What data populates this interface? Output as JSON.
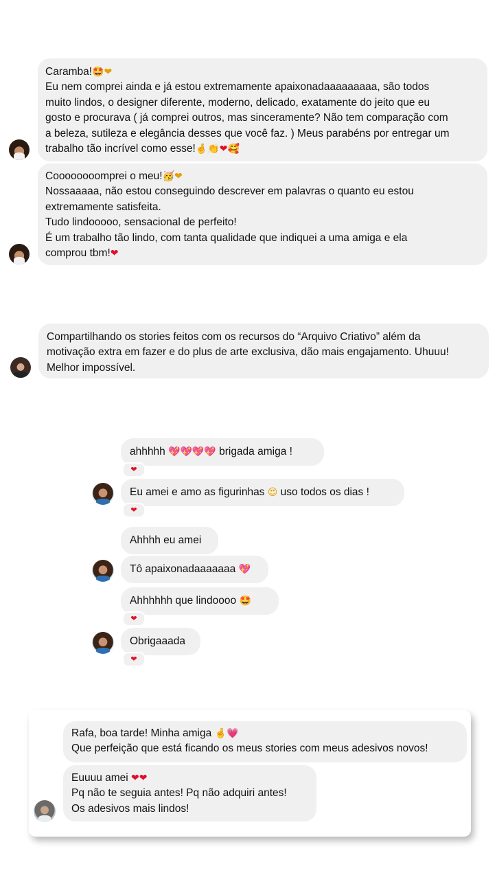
{
  "messages": {
    "m1": {
      "lines": [
        "Caramba!",
        "Eu nem comprei ainda e já estou extremamente apaixonadaaaaaaaaa, são todos",
        "muito lindos, o designer diferente, moderno, delicado, exatamente do jeito que eu",
        "gosto e procurava ( já comprei outros, mas sinceramente? Não tem comparação com",
        "a beleza, sutileza e elegância desses que você faz. ) Meus parabéns por entregar um",
        "trabalho tão incrível como esse!"
      ],
      "emoji_line1": "🤩❤",
      "emoji_last": "🤞👏❤🥰"
    },
    "m2": {
      "lines": [
        "Coooooooomprei o meu!",
        "Nossaaaaa, não estou conseguindo descrever em palavras o quanto eu estou",
        "extremamente satisfeita.",
        "Tudo lindooooo, sensacional de perfeito!",
        "É um trabalho tão lindo, com tanta qualidade que indiquei a uma amiga e ela",
        "comprou tbm!"
      ],
      "emoji_line1": "🥳❤",
      "emoji_last": "❤"
    },
    "m3": {
      "lines": [
        "Compartilhando os stories feitos com os recursos do “Arquivo Criativo” além da",
        "motivação extra em fazer e do plus de arte exclusiva, dão mais engajamento. Uhuuu!",
        "Melhor impossível."
      ]
    },
    "m4": {
      "text": "ahhhhh",
      "emoji": "💖💖💖💖",
      "text_after": "brigada amiga !",
      "reaction": "❤"
    },
    "m5": {
      "text": "Eu amei e amo as figurinhas",
      "emoji": "😍",
      "text_after": "uso todos os dias !",
      "reaction": "❤"
    },
    "m6": {
      "text": "Ahhhh eu amei"
    },
    "m7": {
      "text": "Tô apaixonadaaaaaaa",
      "emoji": "💖"
    },
    "m8": {
      "text": "Ahhhhhh que lindoooo",
      "emoji": "🤩",
      "reaction": "❤"
    },
    "m9": {
      "text": "Obrigaaada",
      "reaction": "❤"
    },
    "m10": {
      "line1": "Rafa, boa tarde! Minha amiga",
      "line1_emoji": "🤞💗",
      "line2": "Que perfeição que está ficando os meus stories com meus adesivos novos!"
    },
    "m11": {
      "line1": "Euuuu amei",
      "line1_emoji": "❤❤",
      "line2": "Pq não te seguia antes! Pq não adquiri antes!",
      "line3": "Os adesivos mais lindos!"
    }
  },
  "colors": {
    "bubble": "#f0f0f0",
    "text": "#111111",
    "heart": "#e0102a"
  }
}
